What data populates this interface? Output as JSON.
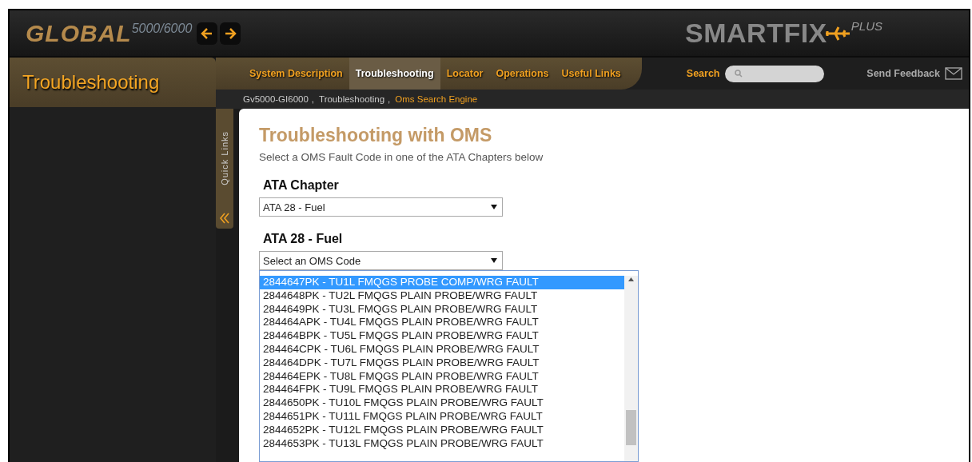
{
  "header": {
    "logo": "GLOBAL",
    "model": "5000/6000",
    "brand": "SMARTFIX",
    "brand_suffix": "PLUS"
  },
  "section_title": "Troubleshooting",
  "nav": [
    {
      "label": "System Description",
      "selected": false
    },
    {
      "label": "Troubleshooting",
      "selected": true
    },
    {
      "label": "Locator",
      "selected": false
    },
    {
      "label": "Operations",
      "selected": false
    },
    {
      "label": "Useful Links",
      "selected": false
    }
  ],
  "search": {
    "label": "Search"
  },
  "feedback": "Send Feedback",
  "breadcrumbs": [
    {
      "label": "Gv5000-GI6000",
      "current": false,
      "separator": ","
    },
    {
      "label": "Troubleshooting",
      "current": false,
      "separator": ","
    },
    {
      "label": "Oms Search Engine",
      "current": true
    }
  ],
  "quick_links": "Quick Links",
  "content": {
    "title": "Troubleshooting with OMS",
    "subtitle": "Select a OMS Fault Code in one of the ATA Chapters below",
    "fields": [
      {
        "label": "ATA Chapter",
        "value": "ATA 28 - Fuel"
      },
      {
        "label": "ATA 28 - Fuel",
        "value": "Select an OMS Code"
      }
    ],
    "options": [
      {
        "label": "2844647PK - TU1L FMQGS PROBE COMP/WRG FAULT",
        "selected": true
      },
      {
        "label": "2844648PK - TU2L FMQGS PLAIN PROBE/WRG FAULT",
        "selected": false
      },
      {
        "label": "2844649PK - TU3L FMQGS PLAIN PROBE/WRG FAULT",
        "selected": false
      },
      {
        "label": "284464APK - TU4L FMQGS PLAIN PROBE/WRG FAULT",
        "selected": false
      },
      {
        "label": "284464BPK - TU5L FMQGS PLAIN PROBE/WRG FAULT",
        "selected": false
      },
      {
        "label": "284464CPK - TU6L FMQGS PLAIN PROBE/WRG FAULT",
        "selected": false
      },
      {
        "label": "284464DPK - TU7L FMQGS PLAIN PROBE/WRG FAULT",
        "selected": false
      },
      {
        "label": "284464EPK - TU8L FMQGS PLAIN PROBE/WRG FAULT",
        "selected": false
      },
      {
        "label": "284464FPK - TU9L FMQGS PLAIN PROBE/WRG FAULT",
        "selected": false
      },
      {
        "label": "2844650PK - TU10L FMQGS PLAIN PROBE/WRG FAULT",
        "selected": false
      },
      {
        "label": "2844651PK - TU11L FMQGS PLAIN PROBE/WRG FAULT",
        "selected": false
      },
      {
        "label": "2844652PK - TU12L FMQGS PLAIN PROBE/WRG FAULT",
        "selected": false
      },
      {
        "label": "2844653PK - TU13L FMQGS PLAIN PROBE/WRG FAULT",
        "selected": false
      }
    ]
  }
}
